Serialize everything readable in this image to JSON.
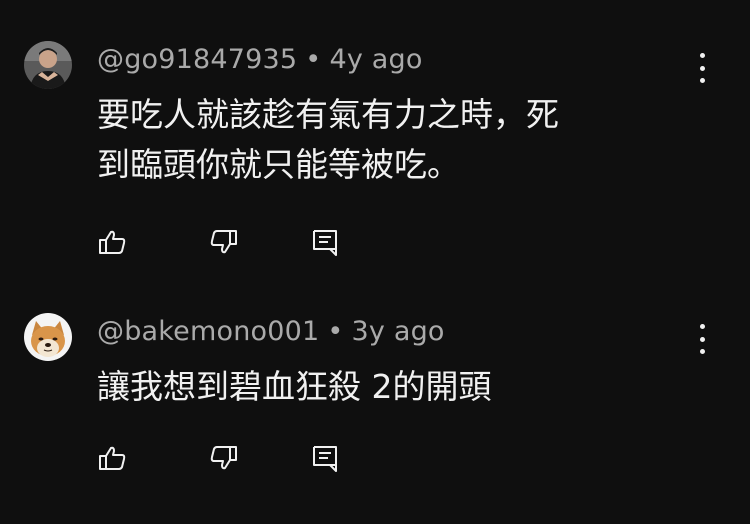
{
  "comments": [
    {
      "username": "@go91847935",
      "separator": "•",
      "time": "4y ago",
      "text": "要吃人就該趁有氣有力之時，死\n到臨頭你就只能等被吃。",
      "avatar": "person-avatar",
      "icons": [
        "thumbs-up-icon",
        "thumbs-down-icon",
        "reply-icon",
        "more-icon"
      ]
    },
    {
      "username": "@bakemono001",
      "separator": "•",
      "time": "3y ago",
      "text": "讓我想到碧血狂殺 2的開頭",
      "avatar": "shiba-dog-avatar",
      "icons": [
        "thumbs-up-icon",
        "thumbs-down-icon",
        "reply-icon",
        "more-icon"
      ]
    }
  ],
  "colors": {
    "background": "#0f0f0f",
    "meta_text": "#aaaaaa",
    "body_text": "#f1f1f1"
  }
}
